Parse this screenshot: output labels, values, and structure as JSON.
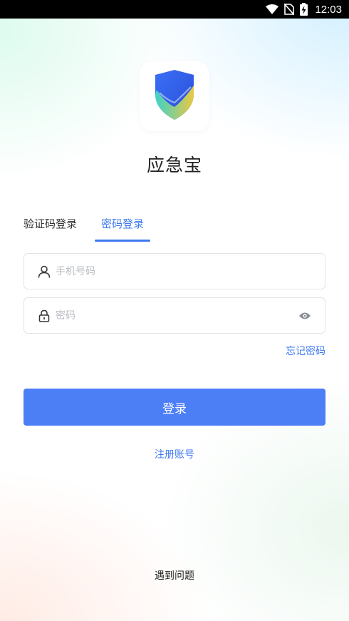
{
  "status_bar": {
    "time": "12:03",
    "icons": [
      "wifi-icon",
      "no-sim-icon",
      "battery-charging-icon"
    ]
  },
  "app": {
    "name": "应急宝",
    "logo_icon": "shield-check-icon"
  },
  "tabs": [
    {
      "label": "验证码登录",
      "active": false
    },
    {
      "label": "密码登录",
      "active": true
    }
  ],
  "form": {
    "phone": {
      "value": "",
      "placeholder": "手机号码",
      "icon": "user-icon"
    },
    "password": {
      "value": "",
      "placeholder": "密码",
      "icon": "lock-icon",
      "toggle_icon": "eye-icon"
    },
    "forgot_label": "忘记密码",
    "login_label": "登录",
    "register_label": "注册账号",
    "help_label": "遇到问题"
  },
  "colors": {
    "accent": "#3d78f0",
    "button": "#4c7ef6",
    "text": "#222222",
    "placeholder": "#b9bcc2"
  }
}
